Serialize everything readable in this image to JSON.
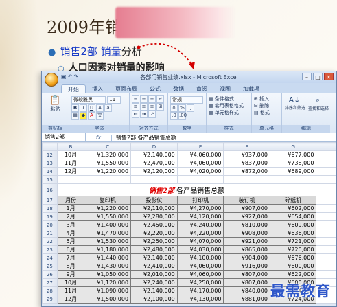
{
  "slide": {
    "title": "2009年销",
    "bullet1": {
      "link1": "销售2部",
      "link2": "销量",
      "rest": "分析"
    },
    "bullet2": "人口因素对销量的影响"
  },
  "excel": {
    "window_title": "各部门销售业绩.xlsx - Microsoft Excel",
    "tabs": [
      "开始",
      "插入",
      "页面布局",
      "公式",
      "数据",
      "审阅",
      "视图",
      "加载项"
    ],
    "active_tab": "开始",
    "ribbon": {
      "paste": "粘贴",
      "font_name": "微软雅黑",
      "font_size": "11",
      "number_format": "常规",
      "groups": [
        "剪贴板",
        "字体",
        "对齐方式",
        "数字",
        "样式",
        "单元格",
        "编辑"
      ],
      "styles": [
        "条件格式",
        "套用表格格式",
        "单元格样式"
      ],
      "cells": [
        "插入",
        "删除",
        "格式"
      ],
      "editing": [
        "排序和筛选",
        "查找和选择"
      ]
    },
    "name_box": "销售2部",
    "fx": "fx",
    "formula": "销售2部   各产品销售总额",
    "columns": [
      "B",
      "C",
      "D",
      "E",
      "F",
      "G"
    ],
    "top_rows": [
      {
        "row": "12",
        "cells": [
          "10月",
          "¥1,320,000",
          "¥2,140,000",
          "¥4,060,000",
          "¥937,000",
          "¥677,000"
        ]
      },
      {
        "row": "13",
        "cells": [
          "11月",
          "¥1,550,000",
          "¥2,470,000",
          "¥4,060,000",
          "¥837,000",
          "¥738,000"
        ]
      },
      {
        "row": "14",
        "cells": [
          "12月",
          "¥1,220,000",
          "¥2,120,000",
          "¥4,020,000",
          "¥872,000",
          "¥689,000"
        ]
      },
      {
        "row": "15",
        "cells": [
          "",
          "",
          "",
          "",
          "",
          ""
        ]
      }
    ],
    "table_title_red": "销售2部",
    "table_title_rest": "各产品销售总额",
    "table_headers": [
      "月份",
      "复印机",
      "投影仪",
      "打印机",
      "装订机",
      "碎纸机"
    ],
    "table_rows": [
      {
        "row": "18",
        "cells": [
          "1月",
          "¥1,220,000",
          "¥2,110,000",
          "¥4,270,000",
          "¥907,000",
          "¥602,000"
        ]
      },
      {
        "row": "19",
        "cells": [
          "2月",
          "¥1,550,000",
          "¥2,280,000",
          "¥4,120,000",
          "¥927,000",
          "¥654,000"
        ]
      },
      {
        "row": "20",
        "cells": [
          "3月",
          "¥1,400,000",
          "¥2,450,000",
          "¥4,240,000",
          "¥810,000",
          "¥609,000"
        ]
      },
      {
        "row": "21",
        "cells": [
          "4月",
          "¥1,470,000",
          "¥2,220,000",
          "¥4,220,000",
          "¥908,000",
          "¥636,000"
        ]
      },
      {
        "row": "22",
        "cells": [
          "5月",
          "¥1,530,000",
          "¥2,250,000",
          "¥4,070,000",
          "¥921,000",
          "¥721,000"
        ]
      },
      {
        "row": "23",
        "cells": [
          "6月",
          "¥1,180,000",
          "¥2,480,000",
          "¥4,030,000",
          "¥865,000",
          "¥720,000"
        ]
      },
      {
        "row": "24",
        "cells": [
          "7月",
          "¥1,440,000",
          "¥2,140,000",
          "¥4,100,000",
          "¥904,000",
          "¥676,000"
        ]
      },
      {
        "row": "25",
        "cells": [
          "8月",
          "¥1,430,000",
          "¥2,410,000",
          "¥4,060,000",
          "¥916,000",
          "¥600,000"
        ]
      },
      {
        "row": "26",
        "cells": [
          "9月",
          "¥1,050,000",
          "¥2,010,000",
          "¥4,060,000",
          "¥807,000",
          "¥622,000"
        ]
      },
      {
        "row": "27",
        "cells": [
          "10月",
          "¥1,120,000",
          "¥2,240,000",
          "¥4,250,000",
          "¥807,000",
          "¥600,000"
        ]
      },
      {
        "row": "28",
        "cells": [
          "11月",
          "¥1,090,000",
          "¥2,140,000",
          "¥4,170,000",
          "¥840,000",
          "¥614,000"
        ]
      },
      {
        "row": "29",
        "cells": [
          "12月",
          "¥1,500,000",
          "¥2,100,000",
          "¥4,130,000",
          "¥881,000",
          "¥724,000"
        ]
      }
    ]
  },
  "watermark": "最需教育",
  "icons": [
    "office-button",
    "save-icon",
    "undo-icon",
    "redo-icon",
    "minimize-icon",
    "maximize-icon",
    "close-icon"
  ]
}
